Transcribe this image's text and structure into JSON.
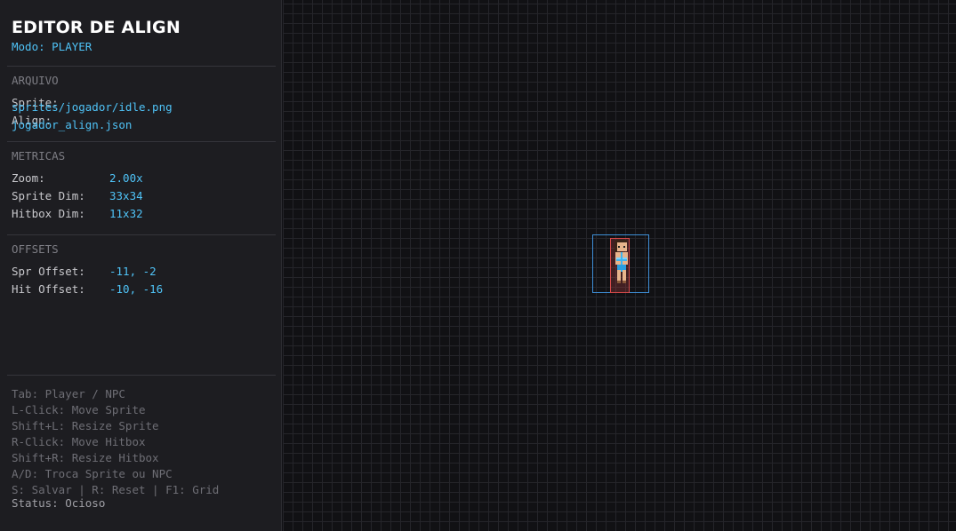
{
  "header": {
    "title": "EDITOR DE ALIGN",
    "mode": "Modo: PLAYER"
  },
  "arquivo": {
    "title": "ARQUIVO",
    "sprite_label": "Sprite:",
    "sprite_value": "sprites/jogador/idle.png",
    "align_label": "Align:",
    "align_value": "jogador_align.json"
  },
  "metricas": {
    "title": "METRICAS",
    "rows": [
      {
        "label": "Zoom:",
        "value": "2.00x"
      },
      {
        "label": "Sprite Dim:",
        "value": "33x34"
      },
      {
        "label": "Hitbox Dim:",
        "value": "11x32"
      }
    ]
  },
  "offsets": {
    "title": "OFFSETS",
    "rows": [
      {
        "label": "Spr Offset:",
        "value": "-11, -2"
      },
      {
        "label": "Hit Offset:",
        "value": "-10, -16"
      }
    ]
  },
  "help": [
    "Tab: Player / NPC",
    "L-Click: Move Sprite",
    "Shift+L: Resize Sprite",
    "R-Click: Move Hitbox",
    "Shift+R: Resize Hitbox",
    "A/D: Troca Sprite ou NPC",
    "S: Salvar | R: Reset | F1: Grid"
  ],
  "status": "Status: Ocioso",
  "colors": {
    "accent": "#4fc3f7",
    "sprite_box": "#3e8ed6",
    "hitbox": "#d64a4a",
    "background": "#111114",
    "panel": "#1d1d21"
  }
}
